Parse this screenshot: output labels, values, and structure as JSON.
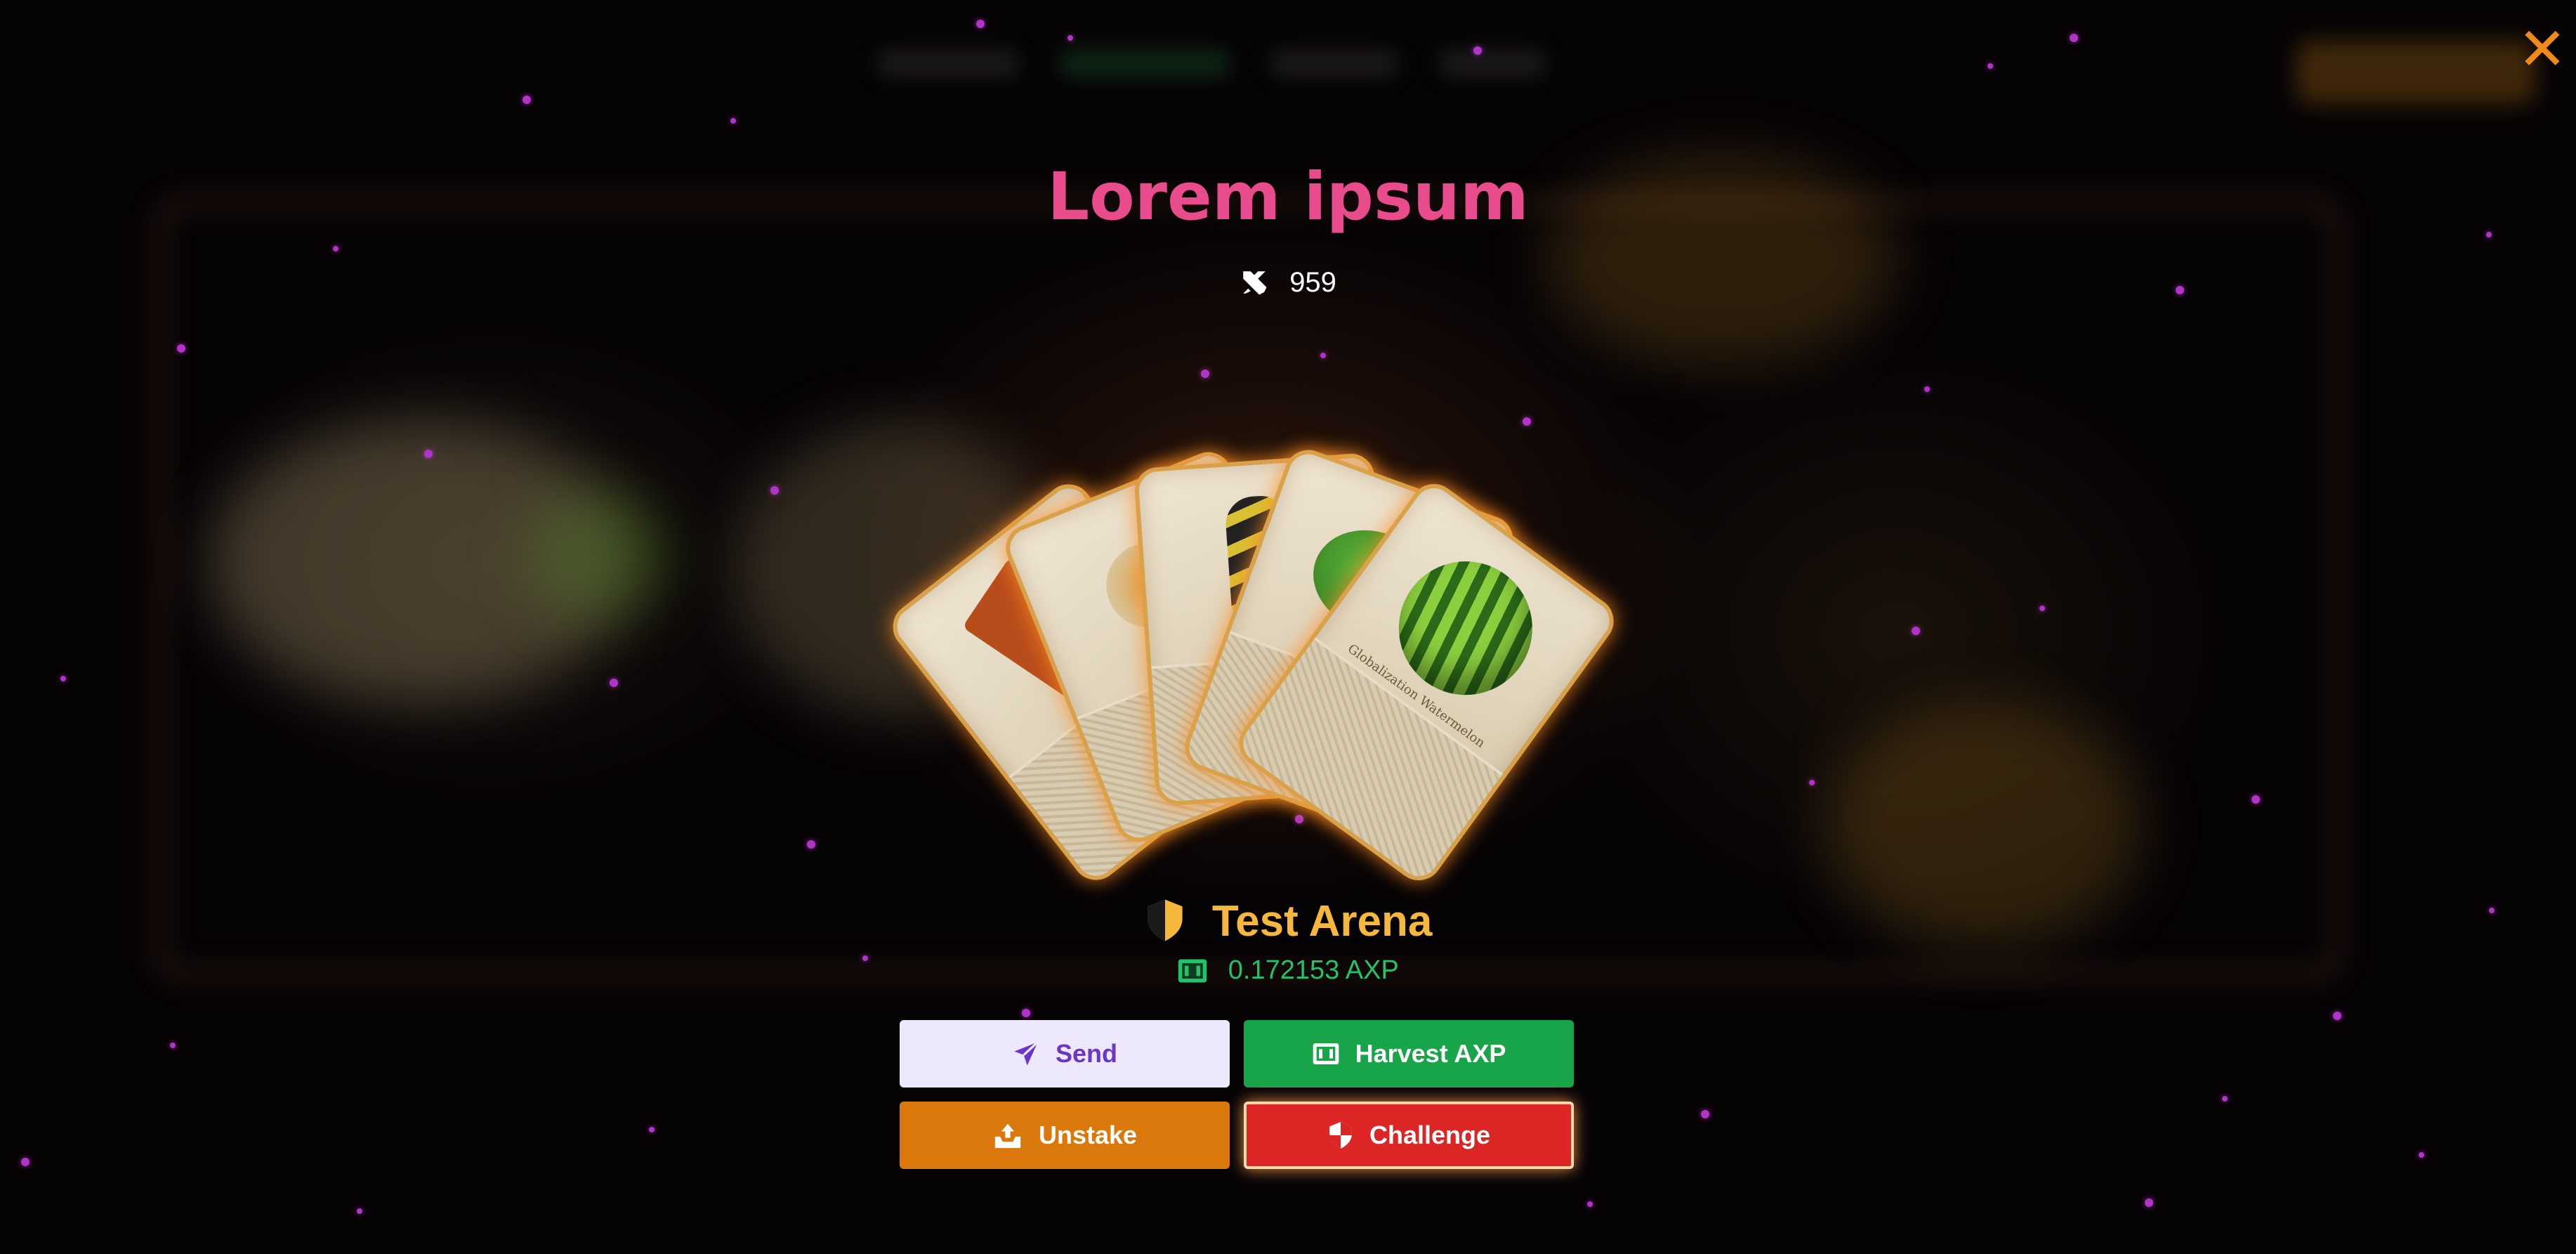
{
  "modal": {
    "title": "Lorem ipsum",
    "power_value": "959",
    "close_icon": "close-icon"
  },
  "cards": [
    {
      "name": "",
      "art_icon": "book-icon"
    },
    {
      "name": "",
      "art_icon": "splatter-icon"
    },
    {
      "name": "",
      "art_icon": "bee-icon"
    },
    {
      "name": "",
      "art_icon": "tree-icon"
    },
    {
      "name": "Globalization Watermelon",
      "art_icon": "watermelon-icon"
    }
  ],
  "arena": {
    "name": "Test Arena",
    "axp_amount": "0.172153 AXP",
    "shield_color": "#f6b83c"
  },
  "actions": {
    "send_label": "Send",
    "harvest_label": "Harvest AXP",
    "unstake_label": "Unstake",
    "challenge_label": "Challenge"
  },
  "colors": {
    "title": "#e94c8c",
    "arena": "#f6b83c",
    "axp": "#23c16b",
    "send_bg": "#ede8fb",
    "harvest_bg": "#18a449",
    "unstake_bg": "#db780c",
    "challenge_bg": "#dc2626",
    "close": "#f08a1a"
  }
}
